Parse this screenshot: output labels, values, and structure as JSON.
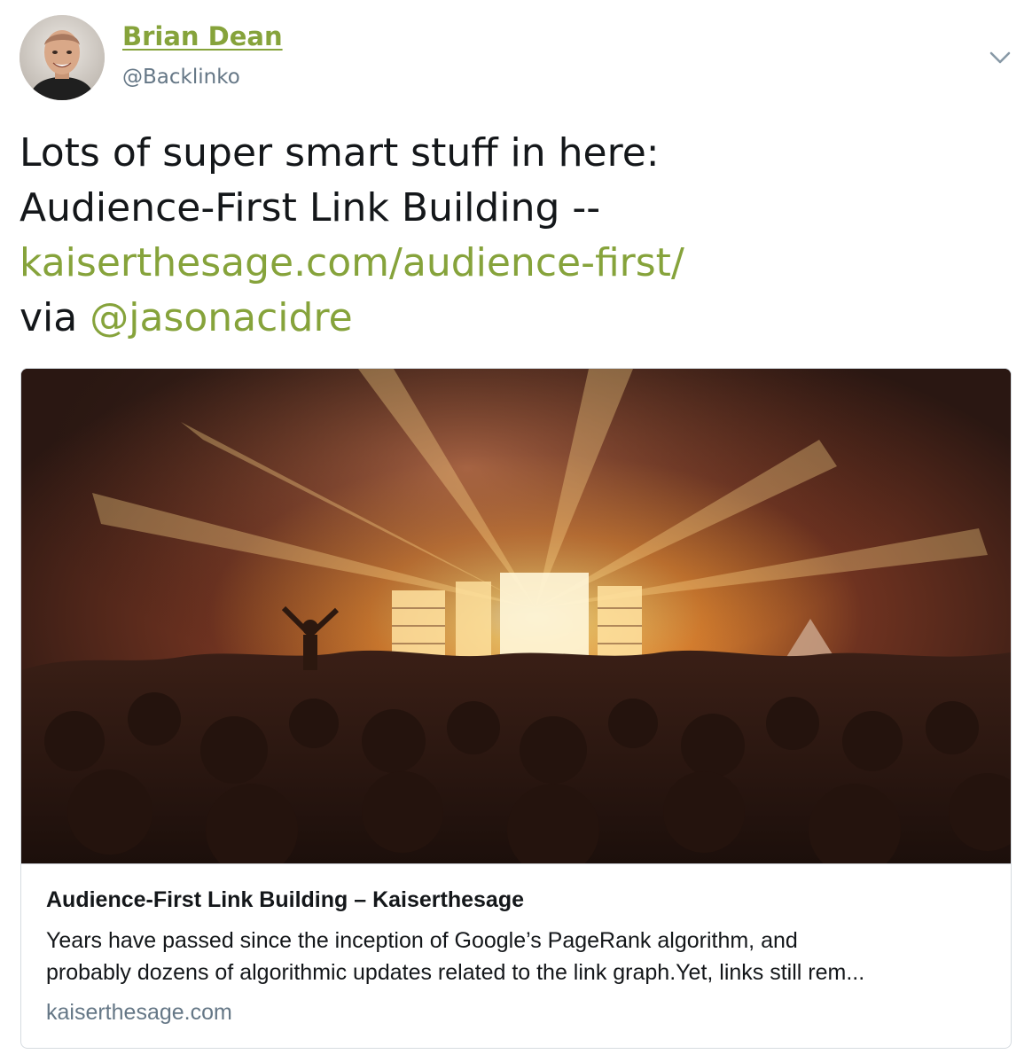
{
  "author": {
    "name": "Brian Dean",
    "handle": "@Backlinko"
  },
  "tweet": {
    "line1": "Lots of super smart stuff in here:",
    "line2": "Audience-First Link Building --",
    "link": "kaiserthesage.com/audience-first/",
    "via_prefix": "via",
    "mention": "@jasonacidre"
  },
  "card": {
    "title": "Audience-First Link Building – Kaiserthesage",
    "description_line1": "Years have passed since the inception of Google’s PageRank algorithm, and",
    "description_line2": "probably dozens of algorithmic updates related to the link graph.Yet, links still rem...",
    "domain": "kaiserthesage.com"
  },
  "icons": {
    "menu": "chevron-down-icon",
    "avatar": "avatar-photo",
    "card_image": "concert-crowd-photo"
  },
  "colors": {
    "accent": "#86a33b",
    "text": "#14171a",
    "secondary": "#657786",
    "border": "#d6dbe0"
  }
}
